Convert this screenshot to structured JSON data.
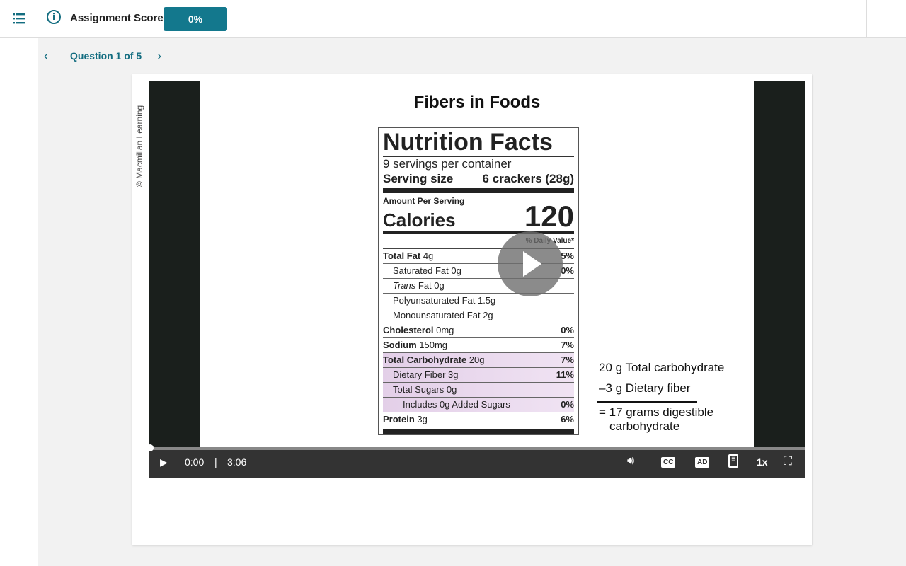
{
  "header": {
    "score_label": "Assignment Score:",
    "score_value": "0%",
    "accent": "#13788d"
  },
  "nav": {
    "question": "Question 1 of 5"
  },
  "slide": {
    "copyright": "© Macmillan Learning",
    "title": "Fibers in Foods",
    "label": {
      "heading": "Nutrition Facts",
      "servings": "9 servings per container",
      "serving_size_label": "Serving size",
      "serving_size_value": "6 crackers (28g)",
      "amount_per_serving": "Amount Per Serving",
      "calories_label": "Calories",
      "calories_value": "120",
      "daily_value_header": "% Daily Value*",
      "rows": [
        {
          "name": "Total Fat",
          "amount": " 4g",
          "pct": "5%"
        },
        {
          "name": "Saturated Fat 0g",
          "amount": "",
          "pct": "0%"
        },
        {
          "name": "Trans",
          "amount": " Fat 0g",
          "pct": ""
        },
        {
          "name": "Polyunsaturated Fat 1.5g",
          "amount": "",
          "pct": ""
        },
        {
          "name": "Monounsaturated Fat 2g",
          "amount": "",
          "pct": ""
        },
        {
          "name": "Cholesterol",
          "amount": " 0mg",
          "pct": "0%"
        },
        {
          "name": "Sodium",
          "amount": " 150mg",
          "pct": "7%"
        },
        {
          "name": "Total Carbohydrate",
          "amount": " 20g",
          "pct": "7%"
        },
        {
          "name": "Dietary Fiber 3g",
          "amount": "",
          "pct": "11%"
        },
        {
          "name": "Total Sugars 0g",
          "amount": "",
          "pct": ""
        },
        {
          "name": "Includes 0g Added Sugars",
          "amount": "",
          "pct": "0%"
        },
        {
          "name": "Protein",
          "amount": " 3g",
          "pct": "6%"
        }
      ]
    },
    "calc": {
      "line1": "20 g Total carbohydrate",
      "line2": "–3 g Dietary fiber",
      "line3": "= 17 grams digestible",
      "line4": "carbohydrate"
    }
  },
  "player": {
    "current": "0:00",
    "separator": "|",
    "duration": "3:06",
    "cc": "CC",
    "ad": "AD",
    "speed": "1x",
    "progress": 0
  }
}
